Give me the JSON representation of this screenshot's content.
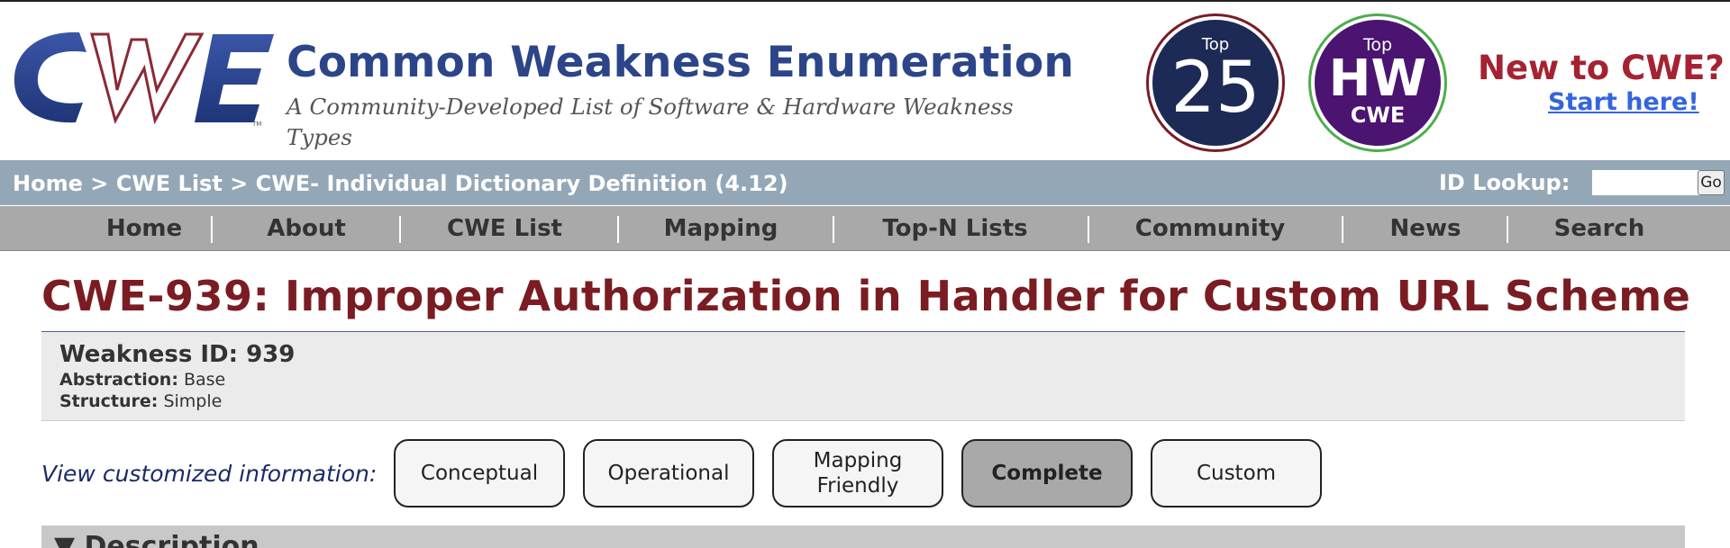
{
  "header": {
    "logo_text": "CWE",
    "title": "Common Weakness Enumeration",
    "tagline": "A Community-Developed List of Software & Hardware Weakness Types",
    "badge_top25": {
      "top": "Top",
      "number": "25"
    },
    "badge_tophw": {
      "top": "Top",
      "main": "HW",
      "sub": "CWE"
    },
    "new_to_cwe": "New to CWE?",
    "start_here": "Start here!"
  },
  "breadcrumb": {
    "home": "Home",
    "sep": ">",
    "cwe_list": "CWE List",
    "current": "CWE- Individual Dictionary Definition (4.12)",
    "id_lookup_label": "ID Lookup:",
    "id_lookup_value": "",
    "go_label": "Go"
  },
  "nav": {
    "items": [
      "Home",
      "About",
      "CWE List",
      "Mapping",
      "Top-N Lists",
      "Community",
      "News",
      "Search"
    ]
  },
  "weakness": {
    "title": "CWE-939: Improper Authorization in Handler for Custom URL Scheme",
    "id_line": "Weakness ID: 939",
    "abstraction_label": "Abstraction:",
    "abstraction_value": "Base",
    "structure_label": "Structure:",
    "structure_value": "Simple"
  },
  "views": {
    "label": "View customized information:",
    "buttons": [
      "Conceptual",
      "Operational",
      "Mapping Friendly",
      "Complete",
      "Custom"
    ],
    "active": "Complete"
  },
  "sections": {
    "description_toggle": "▼",
    "description": "Description"
  },
  "colors": {
    "title_blue": "#2c4589",
    "title_maroon": "#7a1c22",
    "crumb_bar": "#94a7b6",
    "nav_bar": "#a9a9a9",
    "new_to_red": "#a52232",
    "link_blue": "#3366dd"
  }
}
